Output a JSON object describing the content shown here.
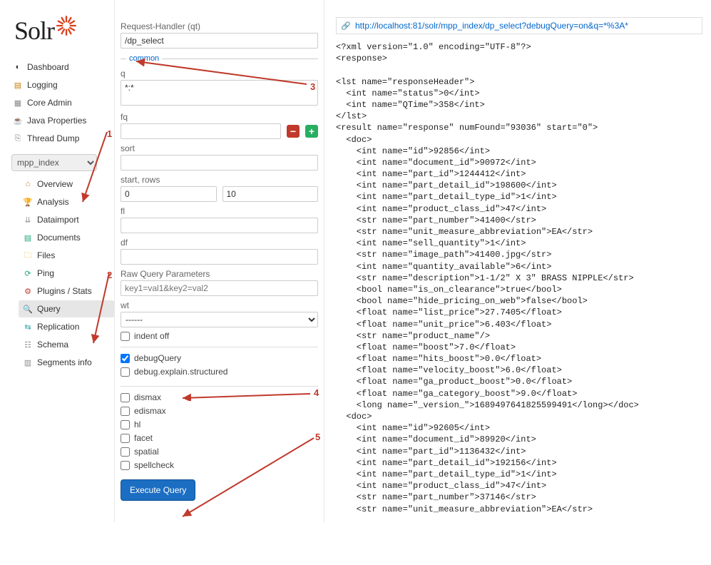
{
  "logo": "Solr",
  "nav": {
    "dashboard": "Dashboard",
    "logging": "Logging",
    "coreadmin": "Core Admin",
    "javaprops": "Java Properties",
    "threaddump": "Thread Dump"
  },
  "core_selected": "mpp_index",
  "core_nav": {
    "overview": "Overview",
    "analysis": "Analysis",
    "dataimport": "Dataimport",
    "documents": "Documents",
    "files": "Files",
    "ping": "Ping",
    "plugins": "Plugins / Stats",
    "query": "Query",
    "replication": "Replication",
    "schema": "Schema",
    "segments": "Segments info"
  },
  "form": {
    "qt_label": "Request-Handler (qt)",
    "qt_value": "/dp_select",
    "legend_common": "common",
    "q_label": "q",
    "q_value": "*:*",
    "fq_label": "fq",
    "fq_value": "",
    "sort_label": "sort",
    "sort_value": "",
    "startrows_label": "start, rows",
    "start_value": "0",
    "rows_value": "10",
    "fl_label": "fl",
    "fl_value": "",
    "df_label": "df",
    "df_value": "",
    "raw_label": "Raw Query Parameters",
    "raw_placeholder": "key1=val1&key2=val2",
    "wt_label": "wt",
    "wt_value": "------",
    "indent_label": "indent off",
    "debugquery_label": "debugQuery",
    "debugexplain_label": "debug.explain.structured",
    "dismax_label": "dismax",
    "edismax_label": "edismax",
    "hl_label": "hl",
    "facet_label": "facet",
    "spatial_label": "spatial",
    "spellcheck_label": "spellcheck",
    "execute_label": "Execute Query"
  },
  "result_url": "http://localhost:81/solr/mpp_index/dp_select?debugQuery=on&q=*%3A*",
  "xml": "<?xml version=\"1.0\" encoding=\"UTF-8\"?>\n<response>\n\n<lst name=\"responseHeader\">\n  <int name=\"status\">0</int>\n  <int name=\"QTime\">358</int>\n</lst>\n<result name=\"response\" numFound=\"93036\" start=\"0\">\n  <doc>\n    <int name=\"id\">92856</int>\n    <int name=\"document_id\">90972</int>\n    <int name=\"part_id\">1244412</int>\n    <int name=\"part_detail_id\">198600</int>\n    <int name=\"part_detail_type_id\">1</int>\n    <int name=\"product_class_id\">47</int>\n    <str name=\"part_number\">41400</str>\n    <str name=\"unit_measure_abbreviation\">EA</str>\n    <int name=\"sell_quantity\">1</int>\n    <str name=\"image_path\">41400.jpg</str>\n    <int name=\"quantity_available\">6</int>\n    <str name=\"description\">1-1/2\" X 3\" BRASS NIPPLE</str>\n    <bool name=\"is_on_clearance\">true</bool>\n    <bool name=\"hide_pricing_on_web\">false</bool>\n    <float name=\"list_price\">27.7405</float>\n    <float name=\"unit_price\">6.403</float>\n    <str name=\"product_name\"/>\n    <float name=\"boost\">7.0</float>\n    <float name=\"hits_boost\">0.0</float>\n    <float name=\"velocity_boost\">6.0</float>\n    <float name=\"ga_product_boost\">0.0</float>\n    <float name=\"ga_category_boost\">9.0</float>\n    <long name=\"_version_\">1689497641825599491</long></doc>\n  <doc>\n    <int name=\"id\">92605</int>\n    <int name=\"document_id\">89920</int>\n    <int name=\"part_id\">1136432</int>\n    <int name=\"part_detail_id\">192156</int>\n    <int name=\"part_detail_type_id\">1</int>\n    <int name=\"product_class_id\">47</int>\n    <str name=\"part_number\">37146</str>\n    <str name=\"unit_measure_abbreviation\">EA</str>",
  "annotations": {
    "n1": "1",
    "n2": "2",
    "n3": "3",
    "n4": "4",
    "n5": "5"
  }
}
